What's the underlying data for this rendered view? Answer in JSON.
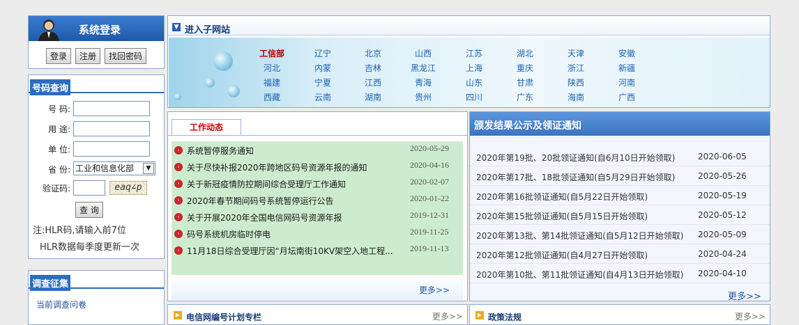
{
  "login": {
    "title": "系统登录",
    "buttons": [
      "登录",
      "注册",
      "找回密码"
    ]
  },
  "query": {
    "title": "号码查询",
    "fields": {
      "number": "号 码:",
      "purpose": "用 途:",
      "unit": "单 位:",
      "province": "省 份:",
      "captcha": "验证码:"
    },
    "province_value": "工业和信息化部",
    "captcha_text": "eaq∠p",
    "submit": "查 询",
    "note1": "注:HLR码,请输入前7位",
    "note2": "HLR数据每季度更新一次"
  },
  "survey": {
    "title": "调查征集",
    "link": "当前调查问卷"
  },
  "subsites": {
    "title": "进入子网站",
    "rows": [
      [
        "工信部",
        "辽宁",
        "北京",
        "山西",
        "江苏",
        "湖北",
        "天津",
        "安徽"
      ],
      [
        "河北",
        "内蒙",
        "吉林",
        "黑龙江",
        "上海",
        "重庆",
        "浙江",
        "新疆"
      ],
      [
        "福建",
        "宁夏",
        "江西",
        "青海",
        "山东",
        "甘肃",
        "陕西",
        "河南"
      ],
      [
        "西藏",
        "云南",
        "湖南",
        "贵州",
        "四川",
        "广东",
        "海南",
        "广西"
      ]
    ]
  },
  "news": {
    "tab": "工作动态",
    "items": [
      {
        "title": "系统暂停服务通知",
        "date": "2020-05-29"
      },
      {
        "title": "关于尽快补报2020年跨地区码号资源年报的通知",
        "date": "2020-04-16"
      },
      {
        "title": "关于新冠疫情防控期间综合受理厅工作通知",
        "date": "2020-02-07"
      },
      {
        "title": "2020年春节期间码号系统暂停运行公告",
        "date": "2020-01-22"
      },
      {
        "title": "关于开展2020年全国电信网码号资源年报",
        "date": "2019-12-31"
      },
      {
        "title": "码号系统机房临时停电",
        "date": "2019-11-25"
      },
      {
        "title": "11月18日综合受理厅因“月坛南街10KV架空入地工程...",
        "date": "2019-11-13"
      }
    ],
    "more": "更多>>"
  },
  "notice": {
    "title": "颁发结果公示及领证通知",
    "items": [
      {
        "title": "2020年第19批、20批领证通知(自6月10日开始领取)",
        "date": "2020-06-05"
      },
      {
        "title": "2020年第17批、18批领证通知(自5月29日开始领取)",
        "date": "2020-05-26"
      },
      {
        "title": "2020年第16批领证通知(自5月22日开始领取)",
        "date": "2020-05-19"
      },
      {
        "title": "2020年第15批领证通知(自5月15日开始领取)",
        "date": "2020-05-12"
      },
      {
        "title": "2020年第13批、第14批领证通知(自5月12日开始领取)",
        "date": "2020-05-09"
      },
      {
        "title": "2020年第12批领证通知(自4月27日开始领取)",
        "date": "2020-04-24"
      },
      {
        "title": "2020年第10批、第11批领证通知(自4月13日开始领取)",
        "date": "2020-04-10"
      }
    ],
    "more": "更多>>"
  },
  "bars": {
    "plan": {
      "title": "电信网编号计划专栏",
      "more": "更多>>"
    },
    "policy": {
      "title": "政策法规",
      "more": "更多>>"
    }
  },
  "colors": {
    "accent": "#2d6cc0",
    "highlight": "#b50000",
    "news_bg": "#cdeccf"
  }
}
